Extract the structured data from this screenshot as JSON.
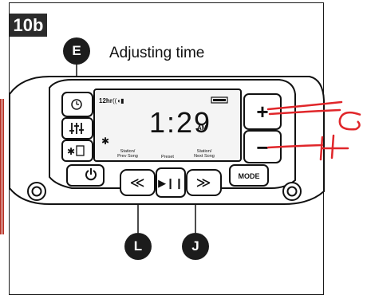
{
  "step_badge": "10b",
  "title": "Adjusting time",
  "callouts": {
    "e": "E",
    "l": "L",
    "j": "J"
  },
  "handwritten": {
    "g": "G",
    "h": "H"
  },
  "display": {
    "mode": "12hr",
    "time": "1:29",
    "ampm": "AM",
    "label_prev": [
      "Station/",
      "Prev Song"
    ],
    "label_preset": "Preset",
    "label_next": [
      "Station/",
      "Next Song"
    ]
  },
  "buttons": {
    "plus": "+",
    "minus": "−",
    "mode": "MODE"
  },
  "colors": {
    "annotation": "#e0262a",
    "frame": "#1a1a1a",
    "badge": "#2b2b2b"
  }
}
